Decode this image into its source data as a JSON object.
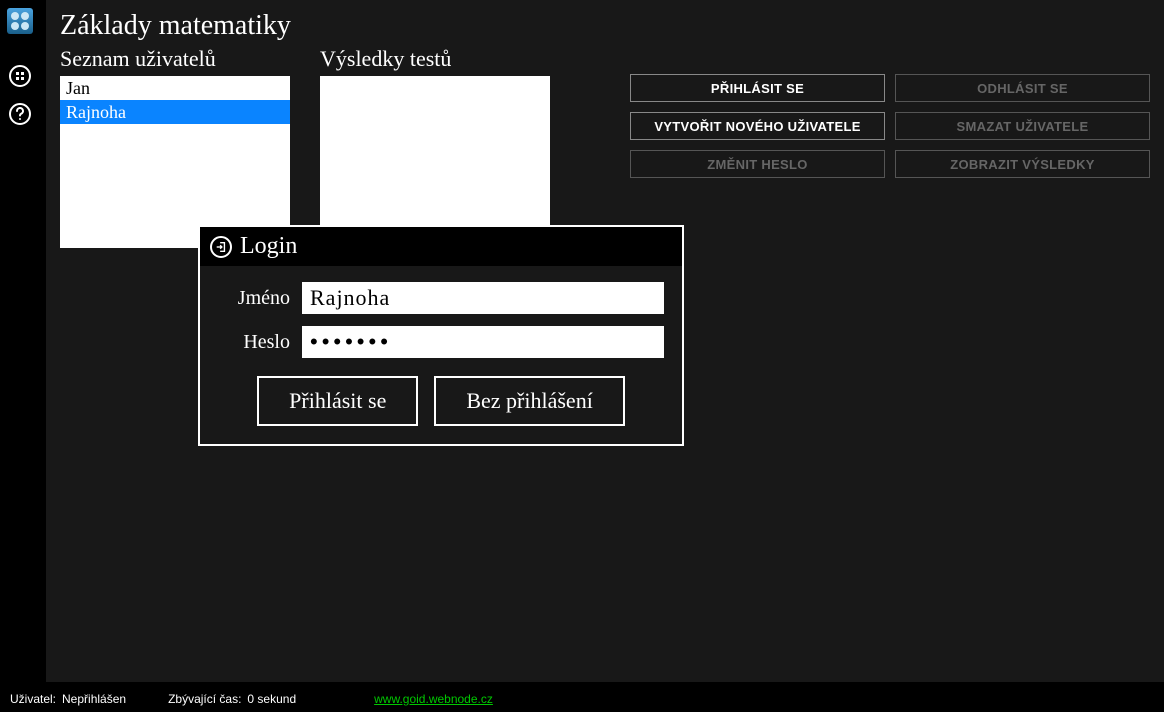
{
  "title": "Základy matematiky",
  "sidebar_icons": {
    "grid": "grid-icon",
    "help": "help-icon"
  },
  "window_controls": {
    "minimize": "minimize",
    "fullscreen": "fullscreen",
    "power": "power"
  },
  "columns": {
    "users_header": "Seznam uživatelů",
    "results_header": "Výsledky testů"
  },
  "users": [
    {
      "name": "Jan",
      "selected": false
    },
    {
      "name": "Rajnoha",
      "selected": true
    }
  ],
  "buttons": {
    "login": "PŘIHLÁSIT SE",
    "logout": "ODHLÁSIT SE",
    "create_user": "VYTVOŘIT NOVÉHO UŽIVATELE",
    "delete_user": "SMAZAT UŽIVATELE",
    "change_password": "ZMĚNIT HESLO",
    "show_results": "ZOBRAZIT VÝSLEDKY"
  },
  "dialog": {
    "title": "Login",
    "username_label": "Jméno",
    "username_value": "Rajnoha",
    "password_label": "Heslo",
    "password_value": "•••••••",
    "submit": "Přihlásit se",
    "skip": "Bez přihlášení"
  },
  "statusbar": {
    "user_label": "Uživatel:",
    "user_value": "Nepřihlášen",
    "time_label": "Zbývající čas:",
    "time_value": "0 sekund",
    "link": "www.goid.webnode.cz"
  }
}
